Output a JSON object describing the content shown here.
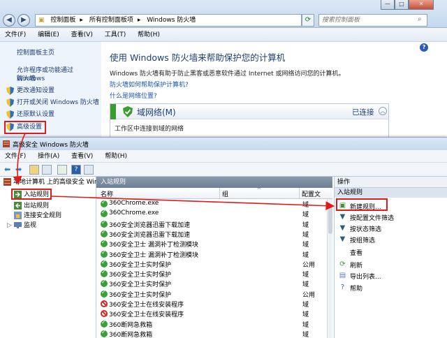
{
  "control_panel": {
    "breadcrumb": [
      "控制面板",
      "所有控制面板项",
      "Windows 防火墙"
    ],
    "search_placeholder": "搜索控制面板",
    "menu": [
      "文件(F)",
      "编辑(E)",
      "查看(V)",
      "工具(T)",
      "帮助(H)"
    ],
    "sidebar": {
      "home": "控制面板主页",
      "allow_program_line1": "允许程序或功能通过 Windows",
      "allow_program_line2": "防火墙",
      "change_notifications": "更改通知设置",
      "toggle_firewall": "打开或关闭 Windows 防火墙",
      "restore_defaults": "还原默认设置",
      "advanced_settings": "高级设置"
    },
    "main": {
      "title": "使用 Windows 防火墙来帮助保护您的计算机",
      "description": "Windows 防火墙有助于防止黑客或恶意软件通过 Internet 或网络访问您的计算机。",
      "link_how": "防火墙如何帮助保护计算机?",
      "link_location": "什么是网络位置?",
      "network": {
        "name": "域网络(M)",
        "status": "已连接",
        "description": "工作区中连接到域的网络"
      },
      "help_icon": "?"
    }
  },
  "advanced_window": {
    "title": "高级安全 Windows 防火墙",
    "menu": [
      "文件(F)",
      "操作(A)",
      "查看(V)",
      "帮助(H)"
    ],
    "tree": {
      "root": "本地计算机 上的高级安全 Wind",
      "inbound": "入站规则",
      "outbound": "出站规则",
      "connection_security": "连接安全规则",
      "monitor": "监视"
    },
    "rules_panel": {
      "title": "入站规则",
      "columns": {
        "name": "名称",
        "group": "组",
        "profile": "配置文"
      },
      "rows": [
        {
          "name": "360Chrome.exe",
          "profile": "域",
          "state": "allow"
        },
        {
          "name": "360Chrome.exe",
          "profile": "域",
          "state": "allow"
        },
        {
          "name": "360安全浏览器迅雷下载加速",
          "profile": "域",
          "state": "allow"
        },
        {
          "name": "360安全浏览器迅雷下载加速",
          "profile": "域",
          "state": "allow"
        },
        {
          "name": "360安全卫士 漏洞补丁检测模块",
          "profile": "域",
          "state": "allow"
        },
        {
          "name": "360安全卫士 漏洞补丁检测模块",
          "profile": "域",
          "state": "allow"
        },
        {
          "name": "360安全卫士实时保护",
          "profile": "公用",
          "state": "allow"
        },
        {
          "name": "360安全卫士实时保护",
          "profile": "域",
          "state": "allow"
        },
        {
          "name": "360安全卫士实时保护",
          "profile": "域",
          "state": "allow"
        },
        {
          "name": "360安全卫士实时保护",
          "profile": "公用",
          "state": "allow"
        },
        {
          "name": "360安全卫士在线安装程序",
          "profile": "域",
          "state": "block"
        },
        {
          "name": "360安全卫士在线安装程序",
          "profile": "域",
          "state": "block"
        },
        {
          "name": "360断网急救箱",
          "profile": "域",
          "state": "allow"
        },
        {
          "name": "360断网急救箱",
          "profile": "域",
          "state": "allow"
        }
      ]
    },
    "actions": {
      "title": "操作",
      "section": "入站规则",
      "items": [
        {
          "label": "新建规则...",
          "icon": "new-rule-icon"
        },
        {
          "label": "按配置文件筛选",
          "icon": "filter-icon"
        },
        {
          "label": "按状态筛选",
          "icon": "filter-icon"
        },
        {
          "label": "按组筛选",
          "icon": "filter-icon"
        },
        {
          "label": "查看",
          "icon": "view-icon"
        },
        {
          "label": "刷新",
          "icon": "refresh-icon"
        },
        {
          "label": "导出列表...",
          "icon": "export-icon"
        },
        {
          "label": "帮助",
          "icon": "help-icon"
        }
      ]
    }
  },
  "colors": {
    "highlight_red": "#e01b1b",
    "allow_green": "#3aa03a",
    "block_red": "#d02a2a",
    "link_blue": "#1a55b0"
  }
}
